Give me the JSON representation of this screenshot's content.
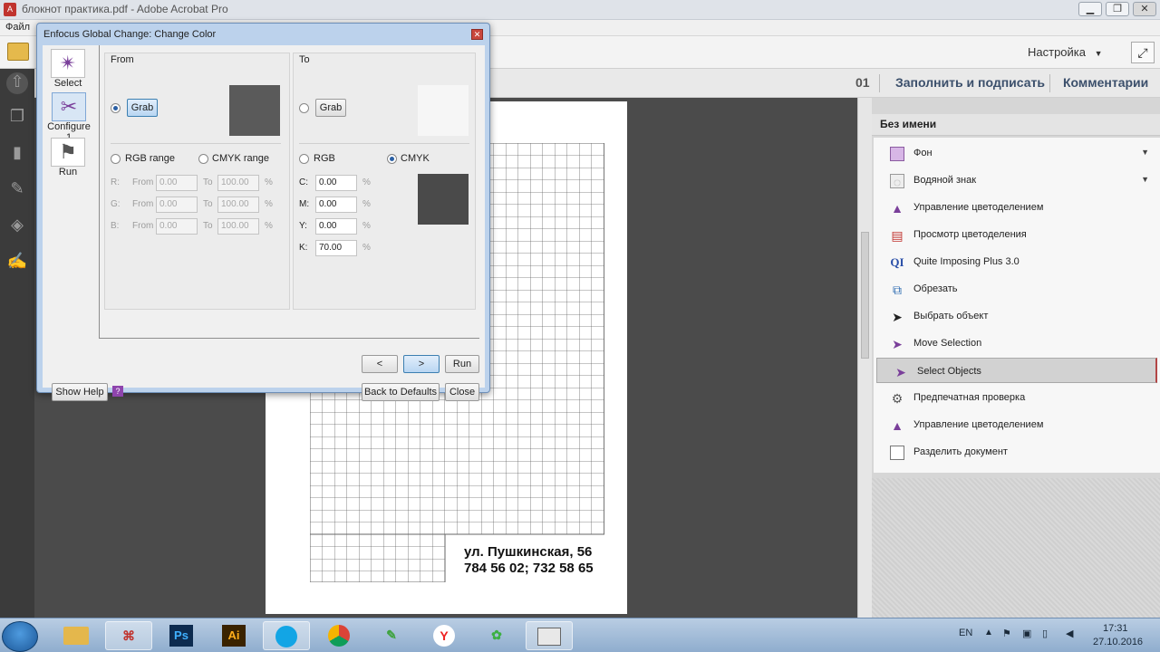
{
  "window": {
    "title": "блокнот практика.pdf - Adobe Acrobat Pro",
    "min": "▁",
    "max": "❐",
    "close": "✕"
  },
  "menu": {
    "file": "Файл"
  },
  "toolbar": {
    "settings": "Настройка",
    "settings_caret": "▼",
    "page_num": "01"
  },
  "tasks": {
    "fill_sign": "Заполнить и подписать",
    "comments": "Комментарии"
  },
  "document": {
    "address_line1": "ул. Пушкинская, 56",
    "address_line2": "784 56 02; 732 58 65"
  },
  "panel": {
    "title": "Без имени",
    "items": [
      {
        "label": "Фон",
        "icon": "background-icon",
        "dropdown": "▼"
      },
      {
        "label": "Водяной знак",
        "icon": "watermark-icon",
        "dropdown": "▼"
      },
      {
        "label": "Управление цветоделением",
        "icon": "color-separation-icon"
      },
      {
        "label": "Просмотр цветоделения",
        "icon": "separation-preview-icon"
      },
      {
        "label": "Quite Imposing Plus 3.0",
        "icon": "quite-imposing-icon",
        "glyph": "QI"
      },
      {
        "label": "Обрезать",
        "icon": "crop-icon"
      },
      {
        "label": "Выбрать объект",
        "icon": "select-object-icon"
      },
      {
        "label": "Move Selection",
        "icon": "move-selection-icon"
      },
      {
        "label": "Select Objects",
        "icon": "select-objects-icon"
      },
      {
        "label": "Предпечатная проверка",
        "icon": "preflight-icon"
      },
      {
        "label": "Управление цветоделением",
        "icon": "color-separation-icon"
      },
      {
        "label": "Разделить документ",
        "icon": "split-document-icon"
      }
    ]
  },
  "dialog": {
    "title": "Enfocus Global Change: Change Color",
    "tools": {
      "select": "Select",
      "configure": "Configure 1",
      "run": "Run"
    },
    "from": {
      "label": "From",
      "grab": "Grab",
      "swatch_color": "#5a5a5a",
      "rgb_range": "RGB range",
      "cmyk_range": "CMYK range",
      "rows": [
        {
          "ch": "R:",
          "from_label": "From",
          "from": "0.00",
          "to_label": "To",
          "to": "100.00",
          "unit": "%"
        },
        {
          "ch": "G:",
          "from_label": "From",
          "from": "0.00",
          "to_label": "To",
          "to": "100.00",
          "unit": "%"
        },
        {
          "ch": "B:",
          "from_label": "From",
          "from": "0.00",
          "to_label": "To",
          "to": "100.00",
          "unit": "%"
        }
      ]
    },
    "to": {
      "label": "To",
      "grab": "Grab",
      "swatch_color": "#f6f6f6",
      "result_color": "#4a4a4a",
      "rgb": "RGB",
      "cmyk": "CMYK",
      "rows": [
        {
          "ch": "C:",
          "value": "0.00",
          "unit": "%"
        },
        {
          "ch": "M:",
          "value": "0.00",
          "unit": "%"
        },
        {
          "ch": "Y:",
          "value": "0.00",
          "unit": "%"
        },
        {
          "ch": "K:",
          "value": "70.00",
          "unit": "%"
        }
      ]
    },
    "buttons": {
      "prev": "<",
      "next": ">",
      "run": "Run",
      "show_help": "Show Help",
      "help_q": "?",
      "back_to_defaults": "Back to Defaults",
      "close": "Close"
    }
  },
  "taskbar": {
    "apps": [
      "explorer-icon",
      "acrobat-icon",
      "photoshop-icon",
      "illustrator-icon",
      "skype-icon",
      "chrome-icon",
      "camtasia-icon",
      "yandex-icon",
      "icq-icon",
      "window-icon"
    ],
    "ps": "Ps",
    "ai": "Ai",
    "ya": "Y",
    "lang": "EN",
    "time": "17:31",
    "date": "27.10.2016"
  },
  "colors": {
    "accent": "#2a5fa4",
    "selected_border": "#b24646",
    "task_text": "#3b4f6b"
  }
}
